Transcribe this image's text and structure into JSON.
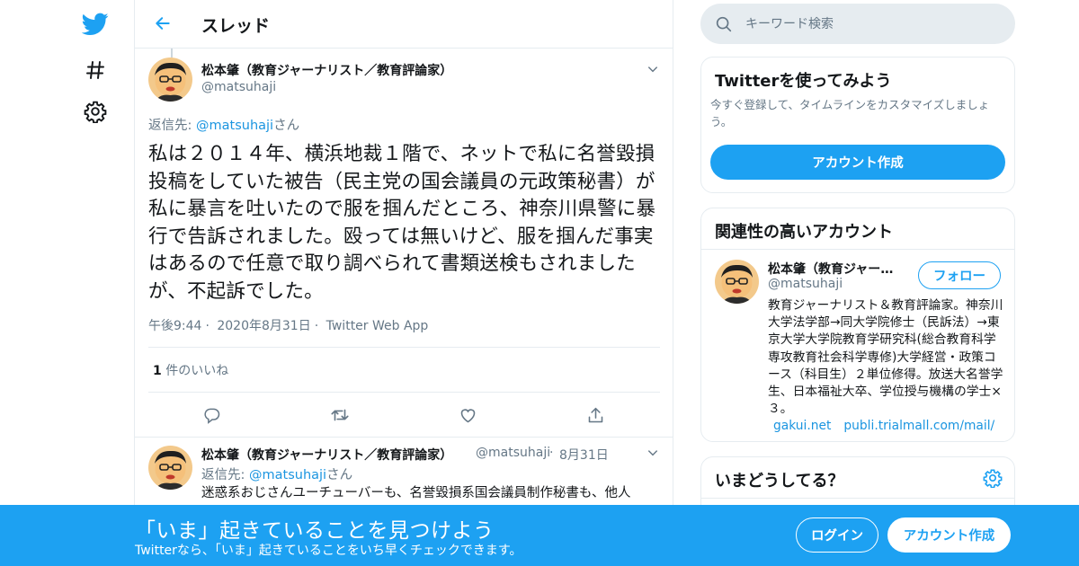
{
  "colors": {
    "accent": "#1da1f2",
    "secondary_text": "#657786",
    "link": "#1b95e0",
    "border": "#e6ecf0"
  },
  "nav": {
    "items": [
      {
        "icon": "twitter-bird-icon"
      },
      {
        "icon": "hashtag-icon"
      },
      {
        "icon": "gear-icon"
      }
    ]
  },
  "header": {
    "title": "スレッド",
    "back_icon": "arrow-left-icon"
  },
  "main_tweet": {
    "author_name": "松本肇（教育ジャーナリスト／教育評論家）",
    "author_handle": "@matsuhaji",
    "reply_prefix": "返信先: ",
    "reply_handle": "@matsuhaji",
    "reply_suffix": "さん",
    "text": "私は２０１４年、横浜地裁１階で、ネットで私に名誉毀損投稿をしていた被告（民主党の国会議員の元政策秘書）が私に暴言を吐いたので服を掴んだところ、神奈川県警に暴行で告訴されました。殴っては無いけど、服を掴んだ事実はあるので任意で取り調べられて書類送検もされましたが、不起訴でした。",
    "time": "午後9:44",
    "date": "2020年8月31日",
    "source": "Twitter Web App",
    "like_count": "1",
    "like_label": " 件のいいね"
  },
  "reply_tweet": {
    "author_name": "松本肇（教育ジャーナリスト／教育評論家）",
    "author_handle": "@matsuhaji",
    "date": "8月31日",
    "reply_prefix": "返信先: ",
    "reply_handle": "@matsuhaji",
    "reply_suffix": "さん",
    "text": "迷惑系おじさんユーチューバーも、名誉毀損系国会議員制作秘書も、他人"
  },
  "search": {
    "placeholder": "キーワード検索"
  },
  "signup_card": {
    "title": "Twitterを使ってみよう",
    "description": "今すぐ登録して、タイムラインをカスタマイズしましょう。",
    "button": "アカウント作成"
  },
  "related_card": {
    "title": "関連性の高いアカウント",
    "name": "松本肇（教育ジャーナリスト／教育評論家）",
    "handle": "@matsuhaji",
    "follow_button": "フォロー",
    "bio": "教育ジャーナリスト＆教育評論家。神奈川大学法学部→同大学院修士（民訴法）→東京大学大学院教育学研究科(総合教育科学専攻教育社会科学専修)大学経営・政策コース（科目生）２単位修得。放送大名誉学生、日本福祉大卒、学位授与機構の学士×３。",
    "links": [
      "gakui.net",
      "publi.trialmall.com/mail/"
    ]
  },
  "trends_card": {
    "title": "いまどうしてる？"
  },
  "banner": {
    "title": "「いま」起きていることを見つけよう",
    "subtitle": "Twitterなら、「いま」起きていることをいち早くチェックできます。",
    "login_button": "ログイン",
    "signup_button": "アカウント作成"
  }
}
